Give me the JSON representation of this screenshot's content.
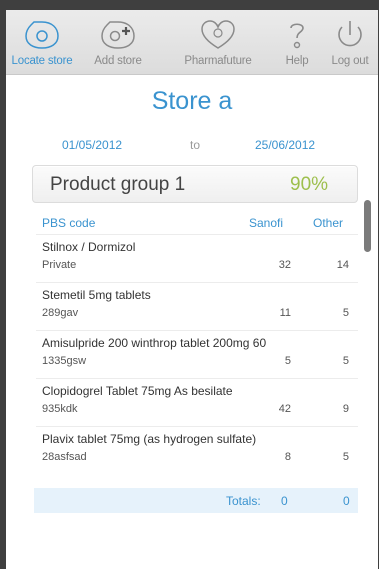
{
  "tabs": [
    {
      "label": "Locate store",
      "icon": "locate-store-icon",
      "active": true
    },
    {
      "label": "Add store",
      "icon": "add-store-icon",
      "active": false
    },
    {
      "label": "Pharmafuture",
      "icon": "pharmafuture-icon",
      "active": false
    },
    {
      "label": "Help",
      "icon": "help-icon",
      "active": false
    },
    {
      "label": "Log out",
      "icon": "power-icon",
      "active": false
    }
  ],
  "store": {
    "title": "Store a",
    "date_from": "01/05/2012",
    "to_label": "to",
    "date_to": "25/06/2012"
  },
  "group": {
    "name": "Product group 1",
    "percent": "90%"
  },
  "table": {
    "headers": {
      "code": "PBS code",
      "sanofi": "Sanofi",
      "other": "Other"
    },
    "rows": [
      {
        "name": "Stilnox / Dormizol",
        "code": "Private",
        "sanofi": "32",
        "other": "14"
      },
      {
        "name": "Stemetil 5mg tablets",
        "code": "289gav",
        "sanofi": "11",
        "other": "5"
      },
      {
        "name": "Amisulpride 200 winthrop tablet 200mg 60",
        "code": "1335gsw",
        "sanofi": "5",
        "other": "5"
      },
      {
        "name": "Clopidogrel Tablet 75mg As besilate",
        "code": "935kdk",
        "sanofi": "42",
        "other": "9"
      },
      {
        "name": "Plavix tablet 75mg (as hydrogen sulfate)",
        "code": "28asfsad",
        "sanofi": "8",
        "other": "5"
      }
    ],
    "totals": {
      "label": "Totals:",
      "sanofi": "0",
      "other": "0"
    }
  },
  "colors": {
    "accent": "#3a93cf",
    "percent_green": "#9dbf4c",
    "totals_bg": "#e6f2fb"
  }
}
